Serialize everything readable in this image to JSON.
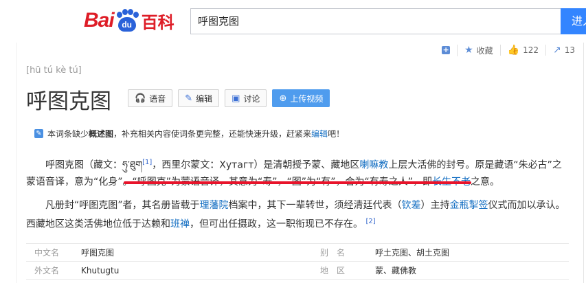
{
  "header": {
    "logo_bai": "Bai",
    "logo_du": "du",
    "logo_baike": "百科",
    "search_value": "呼图克图",
    "search_button": "进入"
  },
  "toolbar": {
    "add": "+",
    "favorite": "收藏",
    "likes": "122",
    "shares": "13"
  },
  "entry": {
    "pinyin": "[hū tú kè tú]",
    "title": "呼图克图",
    "buttons": {
      "voice": "语音",
      "edit": "编辑",
      "discuss": "讨论",
      "upload": "上传视频"
    }
  },
  "notice": {
    "prefix": "本词条缺少",
    "bold": "概述图",
    "middle": "，补充相关内容使词条更完整，还能快速升级，赶紧来",
    "link": "编辑",
    "suffix": "吧！"
  },
  "paragraph1": {
    "t1": "呼图克图（藏文：",
    "tibetan": "ཧུ་ཐུག",
    "ref1": "[1]",
    "t2": "，西里尔蒙文：Хутагт）是清朝授予蒙、藏地区",
    "link1": "喇嘛教",
    "t3": "上层大活佛的封号。原是藏语“朱必古”之蒙语音译，意为“化身”。“呼图克”为蒙语音译，其意为“寿”，“图”为“有”，合为“有寿之人”，即",
    "link2": "长生不老",
    "t4": "之意。"
  },
  "paragraph2": {
    "t1": "凡册封“呼图克图”者，其名册皆载于",
    "link1": "理藩院",
    "t2": "档案中，其下一辈转世，须经清廷代表（",
    "link2": "钦差",
    "t3": "）主持",
    "link3": "金瓶掣签",
    "t4": "仪式而加以承认。西藏地区这类活佛地位低于达赖和",
    "link4": "班禅",
    "t5": "，但可出任摄政，这一职衔现已不存在。",
    "ref2": "[2]"
  },
  "infobox": [
    {
      "k1": "中文名",
      "v1": "呼图克图",
      "k2": "别　名",
      "v2": "呼土克图、胡土克图"
    },
    {
      "k1": "外文名",
      "v1": "Khutugtu",
      "k2": "地　区",
      "v2": "蒙、藏佛教"
    }
  ]
}
